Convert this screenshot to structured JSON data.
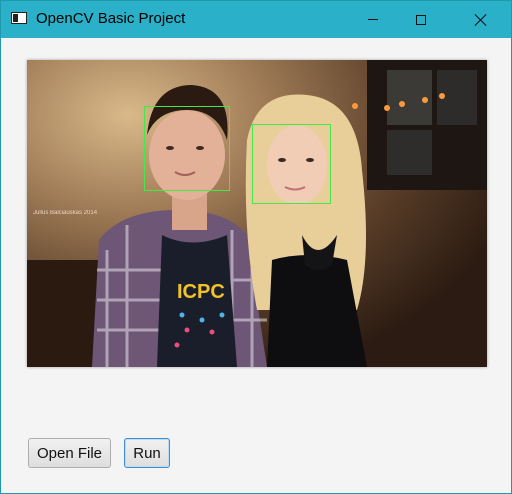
{
  "window": {
    "title": "OpenCV Basic Project",
    "controls": {
      "minimize": "minimize",
      "maximize": "maximize",
      "close": "close"
    }
  },
  "image": {
    "watermark": "Julius Balciauskas 2014",
    "shirt_text": "ICPC",
    "detections": 2,
    "box_color": "#47e64a"
  },
  "buttons": {
    "open_file": "Open File",
    "run": "Run"
  },
  "colors": {
    "titlebar": "#2ab0c8",
    "window_bg": "#f4f4f4"
  }
}
